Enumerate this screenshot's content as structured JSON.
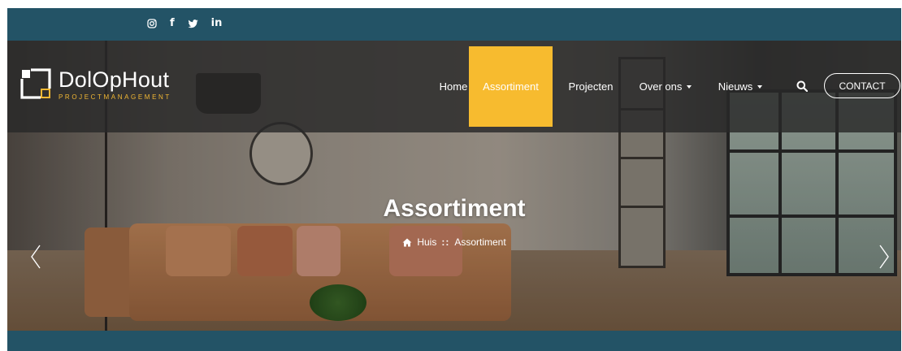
{
  "social": {
    "instagram": "instagram-icon",
    "facebook": "f",
    "twitter": "twitter-icon",
    "linkedin": "in"
  },
  "logo": {
    "name": "DolOpHout",
    "subtitle": "PROJECTMANAGEMENT"
  },
  "nav": {
    "items": [
      {
        "label": "Home",
        "dropdown": false,
        "active": false
      },
      {
        "label": "Assortiment",
        "dropdown": false,
        "active": true
      },
      {
        "label": "Projecten",
        "dropdown": false,
        "active": false
      },
      {
        "label": "Over ons",
        "dropdown": true,
        "active": false
      },
      {
        "label": "Nieuws",
        "dropdown": true,
        "active": false
      }
    ],
    "contact_label": "CONTACT"
  },
  "hero": {
    "title": "Assortiment",
    "breadcrumb": {
      "home": "Huis",
      "separator": "::",
      "current": "Assortiment"
    }
  },
  "colors": {
    "topbar": "#235366",
    "accent": "#f7bb2f",
    "navbar": "#2a2a2a"
  }
}
